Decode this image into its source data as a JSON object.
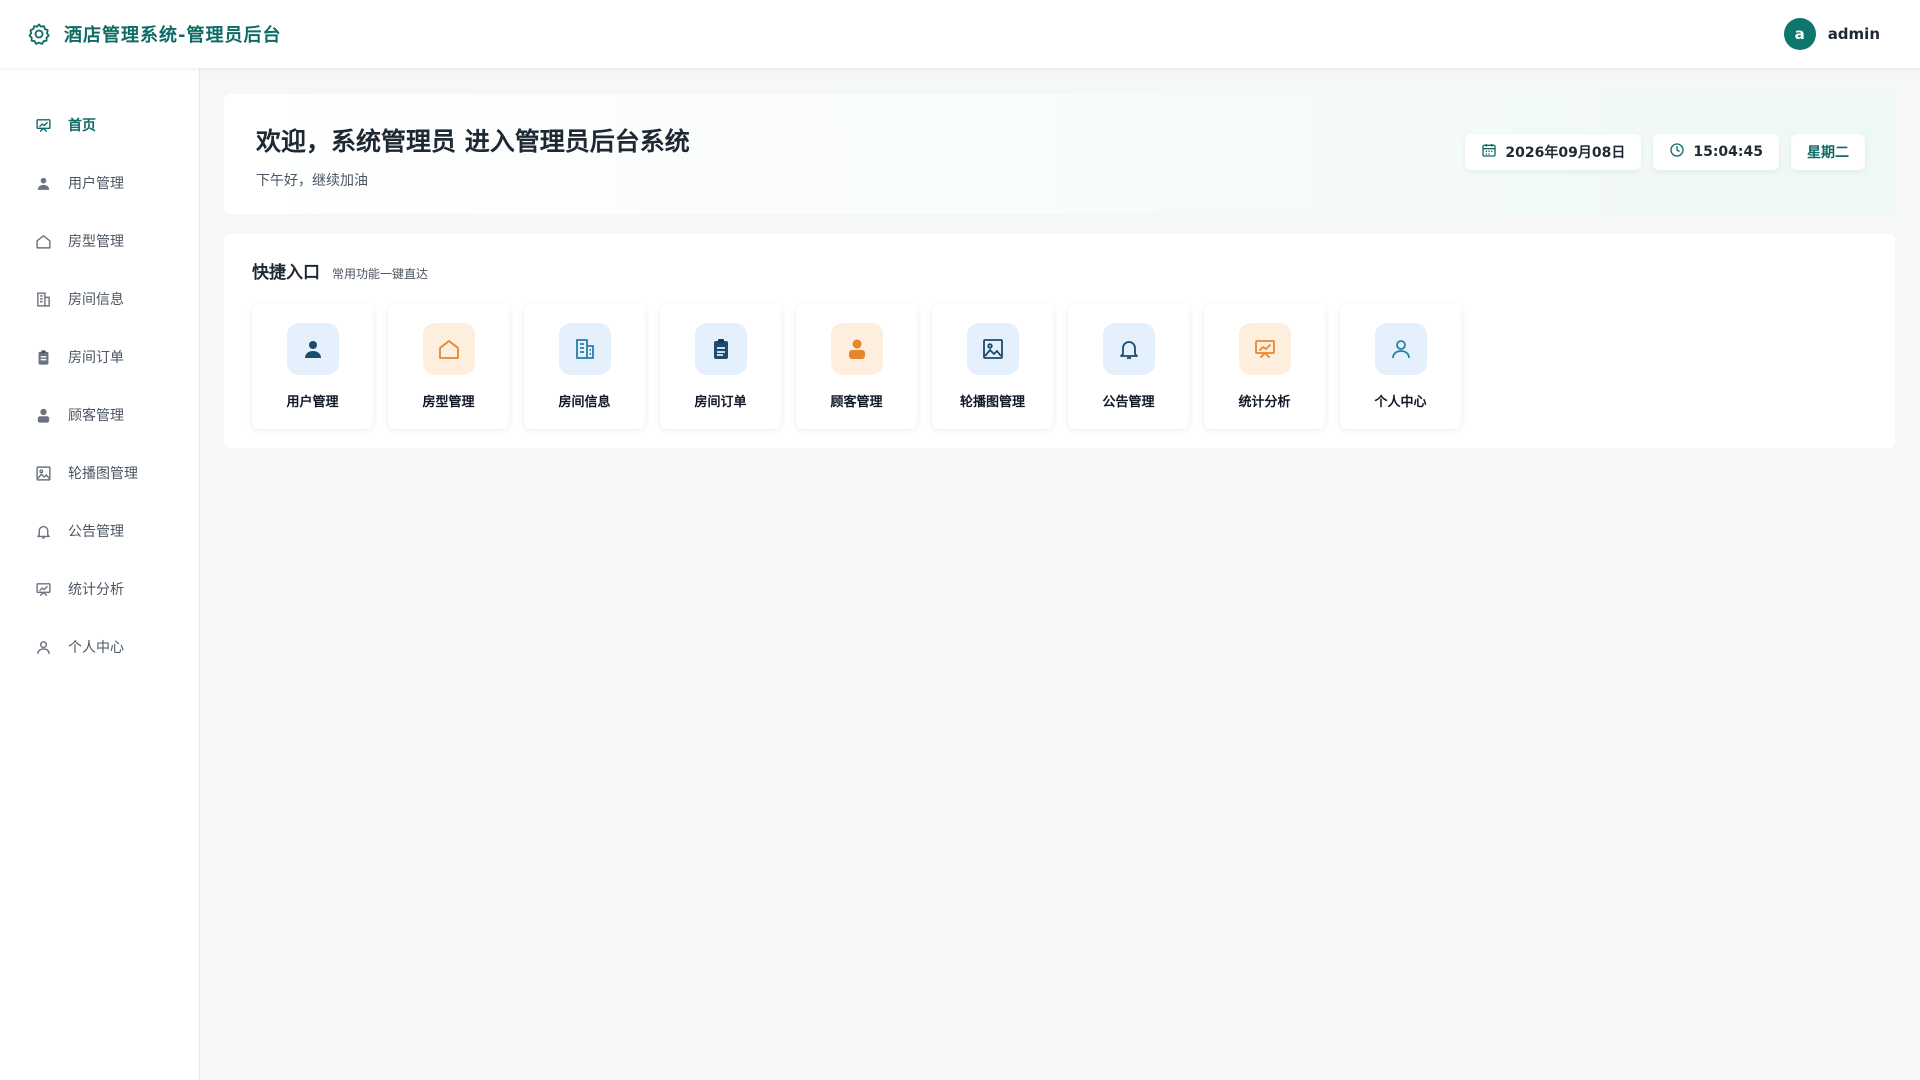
{
  "header": {
    "title": "酒店管理系统-管理员后台",
    "brand_icon": "gear-icon",
    "user": {
      "avatar_letter": "a",
      "name": "admin"
    }
  },
  "sidebar": {
    "items": [
      {
        "label": "首页",
        "icon": "chart-board-icon",
        "active": true
      },
      {
        "label": "用户管理",
        "icon": "user-icon"
      },
      {
        "label": "房型管理",
        "icon": "house-icon"
      },
      {
        "label": "房间信息",
        "icon": "building-icon"
      },
      {
        "label": "房间订单",
        "icon": "clipboard-icon"
      },
      {
        "label": "顾客管理",
        "icon": "person-icon"
      },
      {
        "label": "轮播图管理",
        "icon": "image-icon"
      },
      {
        "label": "公告管理",
        "icon": "bell-icon"
      },
      {
        "label": "统计分析",
        "icon": "chart-board-icon"
      },
      {
        "label": "个人中心",
        "icon": "user-outline-icon"
      }
    ]
  },
  "welcome": {
    "title": "欢迎，系统管理员 进入管理员后台系统",
    "subtitle": "下午好，继续加油",
    "date": "2026年09月08日",
    "time": "15:04:45",
    "weekday": "星期二"
  },
  "quick": {
    "title": "快捷入口",
    "subtitle": "常用功能一键直达",
    "cards": [
      {
        "label": "用户管理",
        "icon": "user-icon",
        "tone": "blue"
      },
      {
        "label": "房型管理",
        "icon": "house-icon",
        "tone": "orange"
      },
      {
        "label": "房间信息",
        "icon": "building-icon",
        "tone": "blue"
      },
      {
        "label": "房间订单",
        "icon": "clipboard-icon",
        "tone": "blue"
      },
      {
        "label": "顾客管理",
        "icon": "person-icon",
        "tone": "orange"
      },
      {
        "label": "轮播图管理",
        "icon": "image-icon",
        "tone": "blue"
      },
      {
        "label": "公告管理",
        "icon": "bell-icon",
        "tone": "blue"
      },
      {
        "label": "统计分析",
        "icon": "chart-board-icon",
        "tone": "orange"
      },
      {
        "label": "个人中心",
        "icon": "user-outline-icon",
        "tone": "blue"
      }
    ]
  },
  "colors": {
    "accent": "#0f6b66",
    "avatar_bg": "#0f766e",
    "icon_dark_blue": "#1e4a6e",
    "icon_orange": "#e8862c",
    "icon_teal": "#2a7fa8"
  }
}
